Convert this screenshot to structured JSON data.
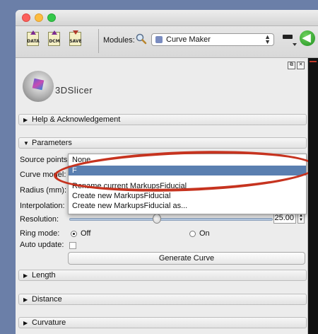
{
  "toolbar": {
    "data_label": "DATA",
    "dcm_label": "DCM",
    "save_label": "SAVE",
    "modules_label": "Modules:",
    "module_selected": "Curve Maker"
  },
  "panel": {
    "logo_text": "3DSlicer",
    "help_section": "Help & Acknowledgement",
    "parameters_section": "Parameters",
    "source_points_label": "Source points:",
    "curve_model_label": "Curve model:",
    "radius_label": "Radius (mm):",
    "interpolation_label": "Interpolation:",
    "resolution_label": "Resolution:",
    "resolution_value": "25.00",
    "resolution_fraction": 0.43,
    "ring_mode_label": "Ring mode:",
    "ring_off_label": "Off",
    "ring_on_label": "On",
    "ring_mode_selected": "Off",
    "auto_update_label": "Auto update:",
    "auto_update_checked": false,
    "generate_button": "Generate Curve",
    "length_section": "Length",
    "distance_section": "Distance",
    "curvature_section": "Curvature"
  },
  "popup": {
    "items": [
      "None",
      "F",
      "Rename current MarkupsFiducial",
      "Create new MarkupsFiducial",
      "Create new MarkupsFiducial as..."
    ],
    "selected": "F"
  },
  "colors": {
    "highlight": "#5a7fb0",
    "annotation_oval": "#c6331f"
  }
}
